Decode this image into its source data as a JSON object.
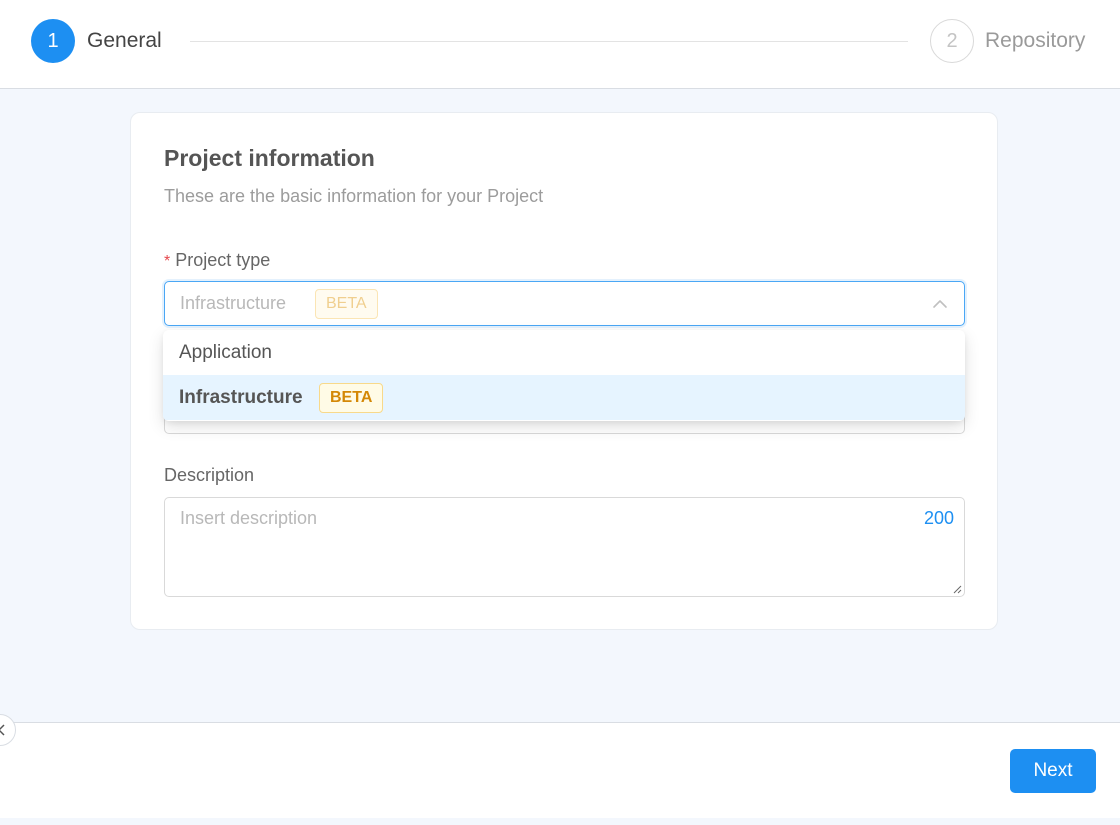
{
  "steps": [
    {
      "number": "1",
      "label": "General",
      "state": "active"
    },
    {
      "number": "2",
      "label": "Repository",
      "state": "inactive"
    }
  ],
  "card": {
    "title": "Project information",
    "subtitle": "These are the basic information for your Project"
  },
  "project_type": {
    "label": "Project type",
    "required_mark": "*",
    "selected_value": "Infrastructure",
    "selected_badge": "BETA",
    "options": [
      {
        "label": "Application",
        "badge": ""
      },
      {
        "label": "Infrastructure",
        "badge": "BETA"
      }
    ]
  },
  "description": {
    "label": "Description",
    "placeholder": "Insert description",
    "remaining_chars": "200"
  },
  "footer": {
    "next_label": "Next"
  },
  "colors": {
    "primary": "#1d8ff2",
    "beta_text": "#d48806",
    "beta_bg": "#fffbe6",
    "selected_option_bg": "#e6f4ff",
    "required": "#e5484d"
  }
}
